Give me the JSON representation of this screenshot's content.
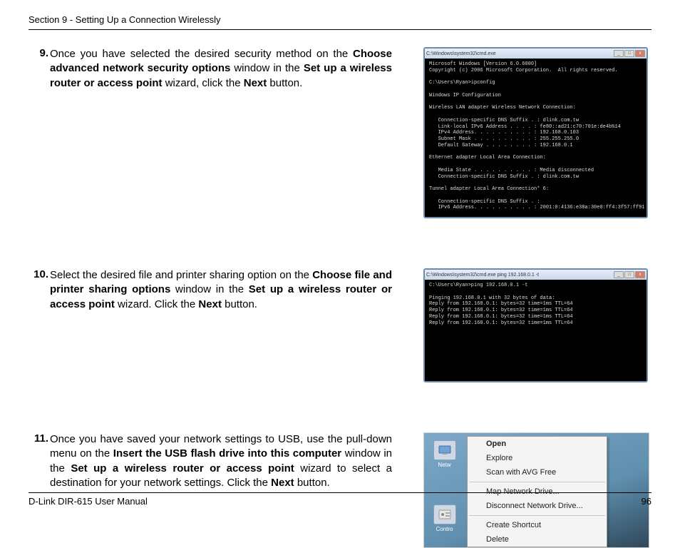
{
  "header": {
    "section": "Section 9 - Setting Up a Connection Wirelessly"
  },
  "steps": [
    {
      "num": "9.",
      "parts": [
        {
          "t": "Once you have selected the desired security method on the ",
          "b": false
        },
        {
          "t": "Choose advanced network security options",
          "b": true
        },
        {
          "t": " window in the ",
          "b": false
        },
        {
          "t": "Set up a wireless router or access point",
          "b": true
        },
        {
          "t": " wizard, click the ",
          "b": false
        },
        {
          "t": "Next",
          "b": true
        },
        {
          "t": " button.",
          "b": false
        }
      ]
    },
    {
      "num": "10.",
      "parts": [
        {
          "t": "Select the desired file and printer sharing option on the ",
          "b": false
        },
        {
          "t": "Choose file and printer sharing options",
          "b": true
        },
        {
          "t": " window in the ",
          "b": false
        },
        {
          "t": "Set up a wireless router or access point",
          "b": true
        },
        {
          "t": " wizard. Click the ",
          "b": false
        },
        {
          "t": "Next",
          "b": true
        },
        {
          "t": " button.",
          "b": false
        }
      ]
    },
    {
      "num": "11.",
      "parts": [
        {
          "t": "Once you have saved your network settings to USB, use the pull-down menu on the ",
          "b": false
        },
        {
          "t": "Insert the USB flash drive into this computer",
          "b": true
        },
        {
          "t": " window in the ",
          "b": false
        },
        {
          "t": "Set up a wireless router or access point",
          "b": true
        },
        {
          "t": " wizard to select a destination for your network settings. Click the ",
          "b": false
        },
        {
          "t": "Next",
          "b": true
        },
        {
          "t": " button.",
          "b": false
        }
      ]
    }
  ],
  "cmd1": {
    "title": "C:\\Windows\\system32\\cmd.exe",
    "lines": "Microsoft Windows [Version 6.0.6000]\nCopyright (c) 2006 Microsoft Corporation.  All rights reserved.\n\nC:\\Users\\Ryan>ipconfig\n\nWindows IP Configuration\n\nWireless LAN adapter Wireless Network Connection:\n\n   Connection-specific DNS Suffix . : dlink.com.tw\n   Link-local IPv6 Address . . . . : fe80::ad21:c70:701e:de4b%14\n   IPv4 Address. . . . . . . . . . : 192.168.0.103\n   Subnet Mask . . . . . . . . . . : 255.255.255.0\n   Default Gateway . . . . . . . . : 192.168.0.1\n\nEthernet adapter Local Area Connection:\n\n   Media State . . . . . . . . . . : Media disconnected\n   Connection-specific DNS Suffix . : dlink.com.tw\n\nTunnel adapter Local Area Connection* 6:\n\n   Connection-specific DNS Suffix . :\n   IPv6 Address. . . . . . . . . . : 2001:0:4136:e38a:30e0:ff4:3f57:ff91"
  },
  "cmd2": {
    "title": "C:\\Windows\\system32\\cmd.exe  ping 192.168.0.1  -t",
    "lines": "C:\\Users\\Ryan>ping 192.168.0.1 -t\n\nPinging 192.168.0.1 with 32 bytes of data:\nReply from 192.168.0.1: bytes=32 time=1ms TTL=64\nReply from 192.168.0.1: bytes=32 time=1ms TTL=64\nReply from 192.168.0.1: bytes=32 time=1ms TTL=64\nReply from 192.168.0.1: bytes=32 time=1ms TTL=64"
  },
  "context_menu": {
    "items": [
      {
        "label": "Open",
        "bold": true
      },
      {
        "label": "Explore"
      },
      {
        "label": "Scan with AVG Free"
      },
      {
        "sep": true
      },
      {
        "label": "Map Network Drive..."
      },
      {
        "label": "Disconnect Network Drive..."
      },
      {
        "sep": true
      },
      {
        "label": "Create Shortcut"
      },
      {
        "label": "Delete"
      }
    ]
  },
  "desktop_icons": [
    {
      "label": "Netw"
    },
    {
      "label": "Contro"
    }
  ],
  "footer": {
    "left": "D-Link DIR-615 User Manual",
    "right": "96"
  }
}
